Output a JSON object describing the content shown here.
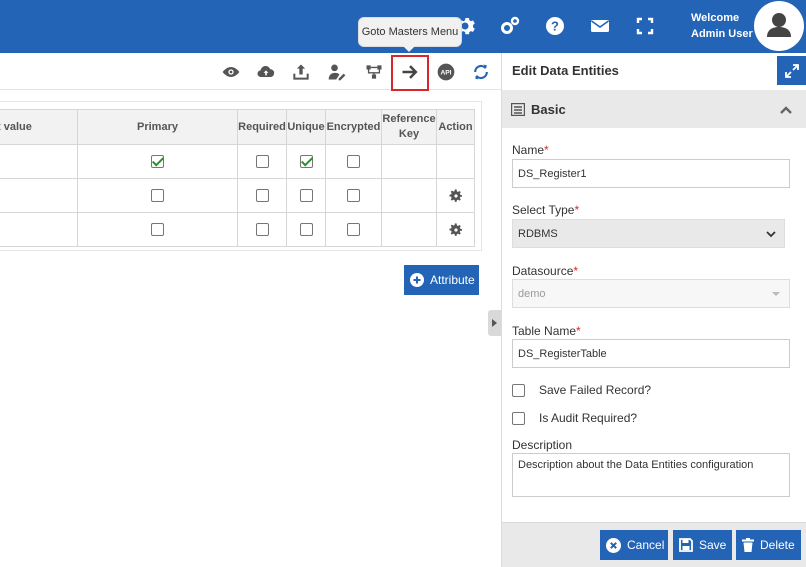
{
  "header": {
    "welcome_line1": "Welcome",
    "welcome_line2": "Admin User",
    "icons": [
      "gear-icon",
      "cogs-icon",
      "help-icon",
      "mail-icon",
      "fullscreen-icon",
      "user-avatar-icon"
    ],
    "bg_color": "#2364b7"
  },
  "tooltip": {
    "text": "Goto Masters Menu"
  },
  "toolbar": {
    "icons": [
      "eye-icon",
      "cloud-upload-icon",
      "upload-icon",
      "user-edit-icon",
      "flow-icon",
      "arrow-right-icon",
      "api-icon",
      "refresh-icon"
    ],
    "api_label": "API"
  },
  "table": {
    "headers": [
      "t value",
      "Primary",
      "Required",
      "Unique",
      "Encrypted",
      "Reference Key",
      "Action"
    ],
    "rows": [
      {
        "primary": true,
        "required": false,
        "unique": true,
        "encrypted": false,
        "action": false
      },
      {
        "primary": false,
        "required": false,
        "unique": false,
        "encrypted": false,
        "action": true
      },
      {
        "primary": false,
        "required": false,
        "unique": false,
        "encrypted": false,
        "action": true
      }
    ]
  },
  "attribute_button": {
    "label": "Attribute"
  },
  "panel": {
    "title": "Edit Data Entities",
    "section_title": "Basic",
    "name_label": "Name",
    "name_value": "DS_Register1",
    "select_type_label": "Select Type",
    "select_type_value": "RDBMS",
    "datasource_label": "Datasource",
    "datasource_value": "demo",
    "table_name_label": "Table Name",
    "table_name_value": "DS_RegisterTable",
    "save_failed_label": "Save Failed Record?",
    "save_failed_checked": false,
    "audit_label": "Is Audit Required?",
    "audit_checked": false,
    "description_label": "Description",
    "description_value": "Description about the Data Entities configuration",
    "required_mark": "*"
  },
  "footer": {
    "cancel_label": "Cancel",
    "save_label": "Save",
    "delete_label": "Delete"
  }
}
